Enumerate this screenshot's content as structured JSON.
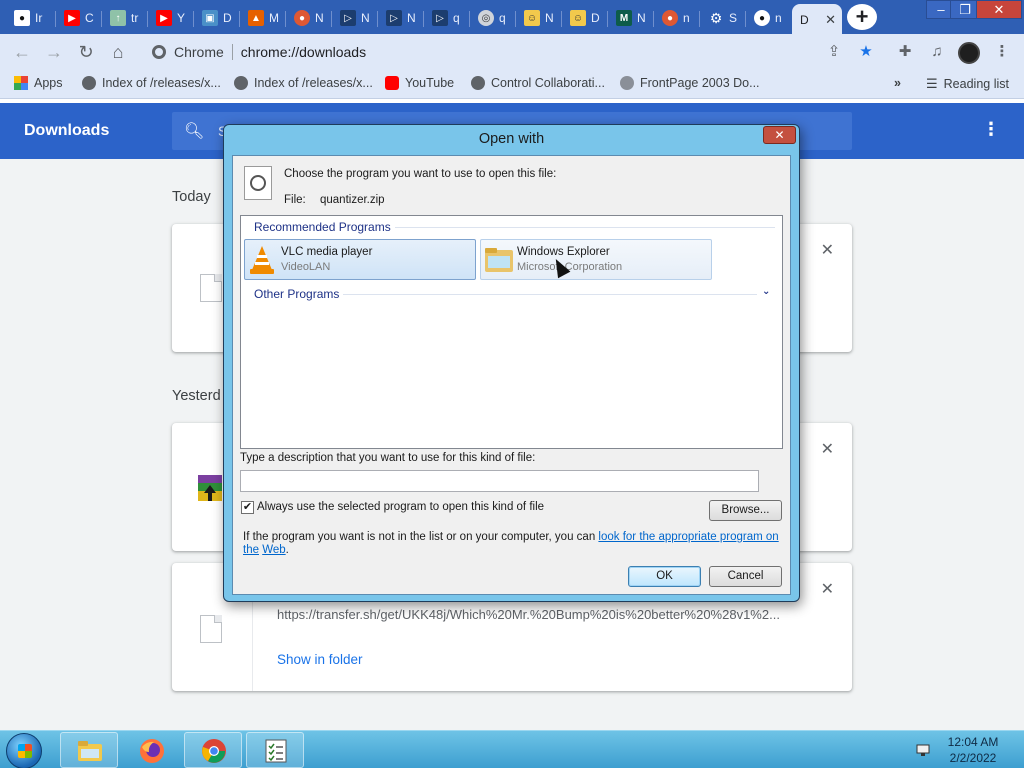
{
  "tabs": [
    {
      "label": "Ir",
      "icon": "github-icon"
    },
    {
      "label": "C",
      "icon": "youtube-icon"
    },
    {
      "label": "tr",
      "icon": "upload-icon"
    },
    {
      "label": "Y",
      "icon": "youtube-icon"
    },
    {
      "label": "D",
      "icon": "image-icon"
    },
    {
      "label": "M",
      "icon": "mozilla-icon"
    },
    {
      "label": "N",
      "icon": "duckduckgo-icon"
    },
    {
      "label": "N",
      "icon": "play-icon"
    },
    {
      "label": "N",
      "icon": "play-icon"
    },
    {
      "label": "q",
      "icon": "play-icon"
    },
    {
      "label": "q",
      "icon": "globe-icon"
    },
    {
      "label": "N",
      "icon": "meme-icon"
    },
    {
      "label": "D",
      "icon": "meme-icon"
    },
    {
      "label": "N",
      "icon": "m-logo-icon"
    },
    {
      "label": "n",
      "icon": "duckduckgo-icon"
    },
    {
      "label": "S",
      "icon": "gear-icon"
    },
    {
      "label": "n",
      "icon": "github-icon"
    },
    {
      "label": "D",
      "icon": "downloads-icon",
      "active": true
    }
  ],
  "toolbar": {
    "site_label": "Chrome",
    "url": "chrome://downloads"
  },
  "bookmarks": [
    {
      "label": "Apps",
      "icon": "apps-grid-icon"
    },
    {
      "label": "Index of /releases/x...",
      "icon": "globe-icon"
    },
    {
      "label": "Index of /releases/x...",
      "icon": "globe-icon"
    },
    {
      "label": "YouTube",
      "icon": "youtube-icon"
    },
    {
      "label": "Control Collaborati...",
      "icon": "globe-icon"
    },
    {
      "label": "FrontPage 2003 Do...",
      "icon": "frontpage-icon"
    }
  ],
  "bookmarks_more": "»",
  "reading_list": "Reading list",
  "downloads": {
    "title": "Downloads",
    "search_placeholder": "S",
    "sections": {
      "today": "Today",
      "yesterday": "Yesterd"
    },
    "item3": {
      "url": "https://transfer.sh/get/UKK48j/Which%20Mr.%20Bump%20is%20better%20%28v1%2...",
      "action": "Show in folder"
    }
  },
  "dialog": {
    "title": "Open with",
    "close": "✕",
    "prompt": "Choose the program you want to use to open this file:",
    "file_label": "File:",
    "file_name": "quantizer.zip",
    "recommended_label": "Recommended Programs",
    "other_label": "Other Programs",
    "programs": [
      {
        "name": "VLC media player",
        "company": "VideoLAN",
        "icon": "vlc-icon",
        "selected": true
      },
      {
        "name": "Windows Explorer",
        "company": "Microsoft Corporation",
        "icon": "explorer-folder-icon",
        "selected": false
      }
    ],
    "description_label": "Type a description that you want to use for this kind of file:",
    "description_value": "",
    "always_use_label": "Always use the selected program to open this kind of file",
    "always_use_checked": true,
    "browse_label": "Browse...",
    "footer_text": "If the program you want is not in the list or on your computer, you can",
    "footer_link_line1": "look for the appropriate program on the",
    "footer_link_line2": "Web",
    "footer_end": ".",
    "ok_label": "OK",
    "cancel_label": "Cancel"
  },
  "taskbar": {
    "apps": [
      {
        "name": "file-explorer",
        "icon": "folder-icon"
      },
      {
        "name": "firefox",
        "icon": "firefox-icon"
      },
      {
        "name": "chrome",
        "icon": "chrome-icon"
      },
      {
        "name": "task",
        "icon": "checklist-icon"
      }
    ],
    "time": "12:04 AM",
    "date": "2/2/2022"
  },
  "colors": {
    "tabstrip": "#2f5fb4",
    "header": "#2c63c9",
    "dialog_frame": "#79c5ea",
    "link": "#1a73e8"
  }
}
